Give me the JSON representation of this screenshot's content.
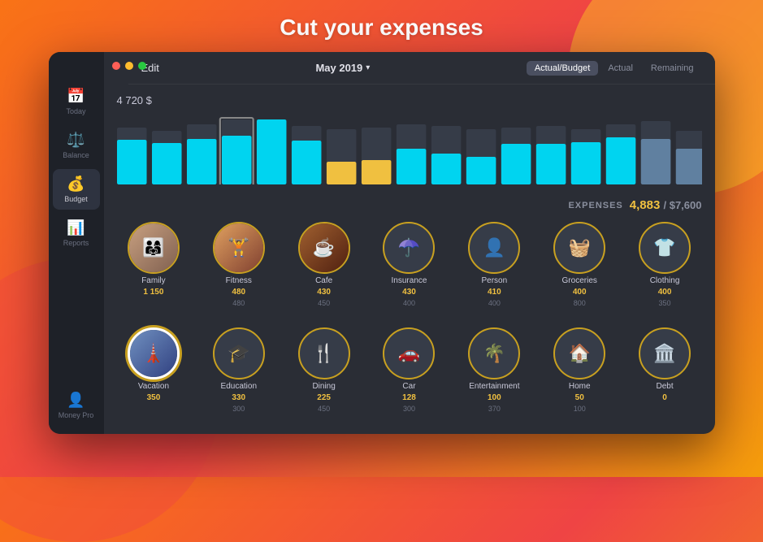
{
  "page": {
    "title": "Cut your expenses"
  },
  "window": {
    "traffic_lights": [
      "red",
      "yellow",
      "green"
    ],
    "edit_label": "Edit",
    "month": "May 2019",
    "view_tabs": [
      "Actual/Budget",
      "Actual",
      "Remaining"
    ],
    "active_tab": "Actual/Budget"
  },
  "sidebar": {
    "items": [
      {
        "id": "today",
        "icon": "📅",
        "label": "Today"
      },
      {
        "id": "balance",
        "icon": "⚖️",
        "label": "Balance"
      },
      {
        "id": "budget",
        "icon": "💰",
        "label": "Budget",
        "active": true
      },
      {
        "id": "reports",
        "icon": "📊",
        "label": "Reports"
      }
    ],
    "bottom": {
      "icon": "👤",
      "label": "Money Pro"
    }
  },
  "chart": {
    "amount": "4 720 $",
    "bars": [
      {
        "bg": 70,
        "actual": 55,
        "color": "cyan"
      },
      {
        "bg": 60,
        "actual": 45,
        "color": "cyan"
      },
      {
        "bg": 75,
        "actual": 50,
        "color": "cyan"
      },
      {
        "bg": 80,
        "actual": 65,
        "color": "cyan",
        "selected": true
      },
      {
        "bg": 65,
        "actual": 80,
        "color": "cyan"
      },
      {
        "bg": 70,
        "actual": 55,
        "color": "cyan"
      },
      {
        "bg": 60,
        "actual": 20,
        "color": "yellow"
      },
      {
        "bg": 65,
        "actual": 25,
        "color": "yellow"
      },
      {
        "bg": 75,
        "actual": 40,
        "color": "cyan"
      },
      {
        "bg": 70,
        "actual": 30,
        "color": "cyan"
      },
      {
        "bg": 60,
        "actual": 25,
        "color": "cyan"
      },
      {
        "bg": 65,
        "actual": 50,
        "color": "cyan"
      },
      {
        "bg": 70,
        "actual": 45,
        "color": "cyan"
      },
      {
        "bg": 60,
        "actual": 55,
        "color": "cyan"
      },
      {
        "bg": 75,
        "actual": 65,
        "color": "cyan"
      },
      {
        "bg": 80,
        "actual": 70,
        "color": "cyan"
      },
      {
        "bg": 55,
        "actual": 30,
        "color": "cyan"
      }
    ]
  },
  "expenses": {
    "label": "EXPENSES",
    "actual": "4,883",
    "separator": "/",
    "budget": "$7,600"
  },
  "categories": [
    {
      "id": "family",
      "name": "Family",
      "actual": "1 150",
      "budget": null,
      "icon": "👨‍👩‍👧",
      "type": "photo",
      "color": "#c8a080"
    },
    {
      "id": "fitness",
      "name": "Fitness",
      "actual": "480",
      "budget": "480",
      "icon": "🏋️",
      "type": "photo",
      "color": "#d49060"
    },
    {
      "id": "cafe",
      "name": "Cafe",
      "actual": "430",
      "budget": "450",
      "icon": "☕",
      "type": "photo",
      "color": "#8b4513"
    },
    {
      "id": "insurance",
      "name": "Insurance",
      "actual": "430",
      "budget": "400",
      "icon": "☂️",
      "type": "icon",
      "color": "#4a5060"
    },
    {
      "id": "person",
      "name": "Person",
      "actual": "410",
      "budget": "400",
      "icon": "👤",
      "type": "icon",
      "color": "#4a5060"
    },
    {
      "id": "groceries",
      "name": "Groceries",
      "actual": "400",
      "budget": "800",
      "icon": "🧺",
      "type": "icon",
      "color": "#4a5060"
    },
    {
      "id": "clothing",
      "name": "Clothing",
      "actual": "400",
      "budget": "350",
      "icon": "👕",
      "type": "icon",
      "color": "#4a5060"
    },
    {
      "id": "vacation",
      "name": "Vacation",
      "actual": "350",
      "budget": null,
      "icon": "🗼",
      "type": "photo-selected",
      "color": "#8090b0"
    },
    {
      "id": "education",
      "name": "Education",
      "actual": "330",
      "budget": "300",
      "icon": "🎓",
      "type": "icon",
      "color": "#4a5060"
    },
    {
      "id": "dining",
      "name": "Dining",
      "actual": "225",
      "budget": "450",
      "icon": "🍴",
      "type": "icon",
      "color": "#4a5060"
    },
    {
      "id": "car",
      "name": "Car",
      "actual": "128",
      "budget": "300",
      "icon": "🚗",
      "type": "icon",
      "color": "#4a5060"
    },
    {
      "id": "entertainment",
      "name": "Entertainment",
      "actual": "100",
      "budget": "370",
      "icon": "🌴",
      "type": "icon",
      "color": "#4a5060"
    },
    {
      "id": "home",
      "name": "Home",
      "actual": "50",
      "budget": "100",
      "icon": "🏠",
      "type": "icon",
      "color": "#4a5060"
    },
    {
      "id": "debt",
      "name": "Debt",
      "actual": "0",
      "budget": null,
      "icon": "🏛️",
      "type": "icon",
      "color": "#4a5060"
    }
  ]
}
